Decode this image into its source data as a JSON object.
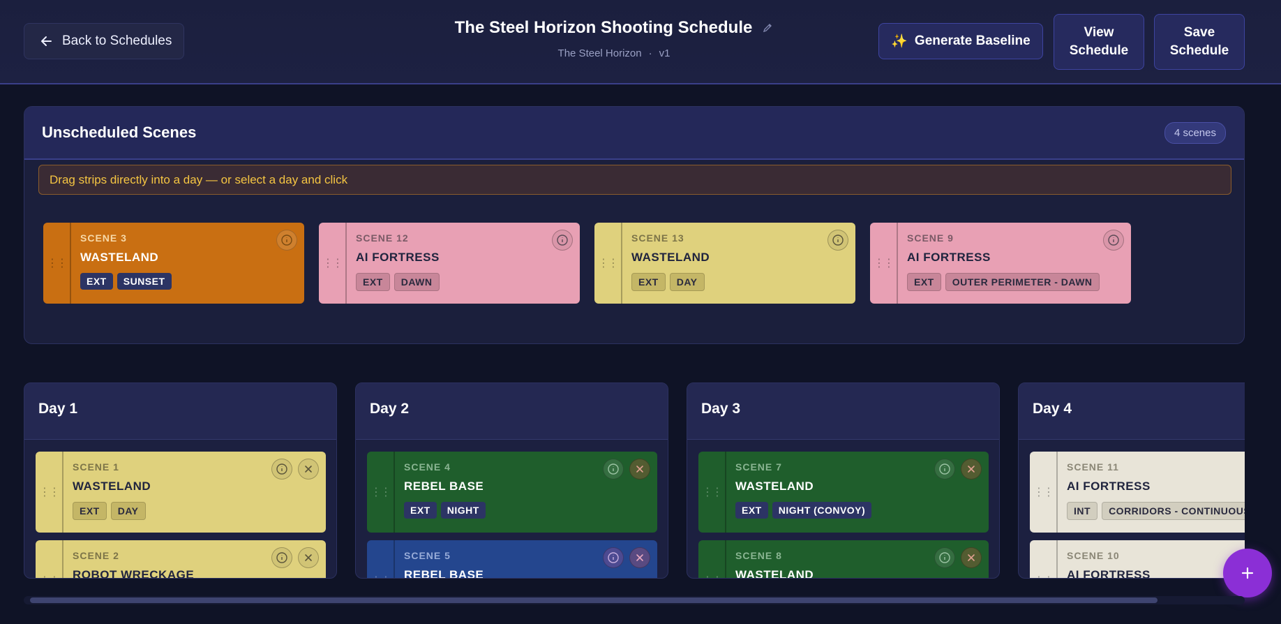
{
  "header": {
    "back_label": "Back to Schedules",
    "title": "The Steel Horizon Shooting Schedule",
    "project": "The Steel Horizon",
    "separator": "·",
    "version": "v1",
    "generate_label": "Generate Baseline",
    "generate_icon": "✨",
    "view_label_1": "View",
    "view_label_2": "Schedule",
    "save_label_1": "Save",
    "save_label_2": "Schedule"
  },
  "unscheduled": {
    "title": "Unscheduled Scenes",
    "count": "4 scenes",
    "hint": "Drag strips directly into a day — or select a day and click",
    "scenes": [
      {
        "num": "SCENE 3",
        "location": "WASTELAND",
        "tags": [
          "EXT",
          "SUNSET"
        ],
        "color": "#c96f12"
      },
      {
        "num": "SCENE 12",
        "location": "AI FORTRESS",
        "tags": [
          "EXT",
          "DAWN"
        ],
        "color": "#e8a0b4"
      },
      {
        "num": "SCENE 13",
        "location": "WASTELAND",
        "tags": [
          "EXT",
          "DAY"
        ],
        "color": "#dfd17d"
      },
      {
        "num": "SCENE 9",
        "location": "AI FORTRESS",
        "tags": [
          "EXT",
          "OUTER PERIMETER - DAWN"
        ],
        "color": "#e8a0b4"
      }
    ]
  },
  "days": [
    {
      "label": "Day 1",
      "scenes": [
        {
          "num": "SCENE 1",
          "location": "WASTELAND",
          "tags": [
            "EXT",
            "DAY"
          ]
        },
        {
          "num": "SCENE 2",
          "location": "ROBOT WRECKAGE"
        }
      ]
    },
    {
      "label": "Day 2",
      "scenes": [
        {
          "num": "SCENE 4",
          "location": "REBEL BASE",
          "tags": [
            "EXT",
            "NIGHT"
          ]
        },
        {
          "num": "SCENE 5",
          "location": "REBEL BASE"
        }
      ]
    },
    {
      "label": "Day 3",
      "scenes": [
        {
          "num": "SCENE 7",
          "location": "WASTELAND",
          "tags": [
            "EXT",
            "NIGHT (CONVOY)"
          ]
        },
        {
          "num": "SCENE 8",
          "location": "WASTELAND"
        }
      ]
    },
    {
      "label": "Day 4",
      "scenes": [
        {
          "num": "SCENE 11",
          "location": "AI FORTRESS",
          "tags": [
            "INT",
            "CORRIDORS - CONTINUOUS"
          ]
        },
        {
          "num": "SCENE 10",
          "location": "AI FORTRESS"
        }
      ]
    }
  ],
  "fab": {
    "icon": "plus-icon"
  },
  "colors": {
    "background": "#0f1326",
    "accent": "#8b2fd6",
    "hint_text": "#f5c542"
  }
}
